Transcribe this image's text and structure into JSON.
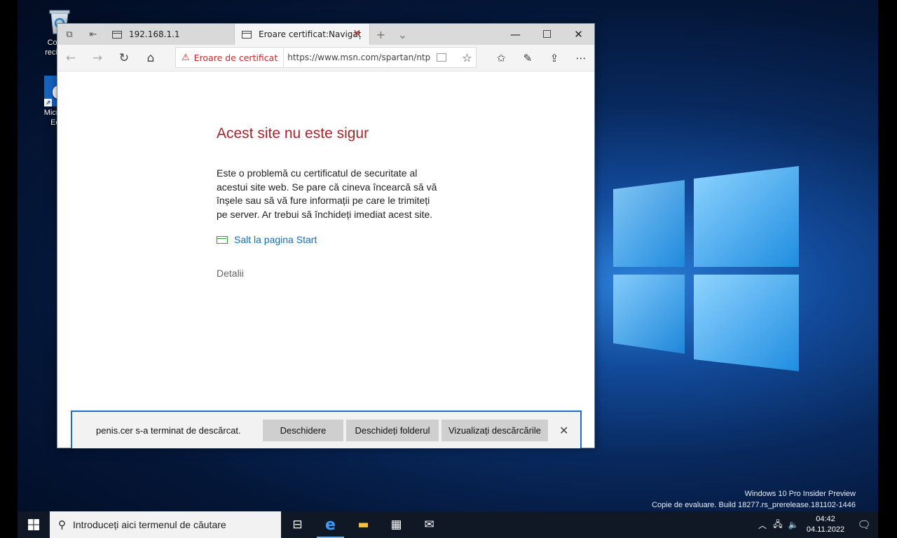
{
  "desktop": {
    "icons": [
      {
        "label": "Coș de reciclare"
      },
      {
        "label": "Microsoft Edge"
      }
    ],
    "watermark": {
      "line1": "Windows 10 Pro Insider Preview",
      "line2": "Copie de evaluare. Build 18277.rs_prerelease.181102-1446"
    }
  },
  "browser": {
    "tabs": [
      {
        "title": "192.168.1.1"
      },
      {
        "title": "Eroare certificat:Navigaț"
      }
    ],
    "address": {
      "cert_label": "Eroare de certificat",
      "url": "https://www.msn.com/spartan/ntp?lo"
    },
    "page": {
      "title": "Acest site nu este sigur",
      "body": "Este o problemă cu certificatul de securitate al acestui site web. Se pare că cineva încearcă să vă înșele sau să vă fure informații pe care le trimiteți pe server. Ar trebui să închideți imediat acest site.",
      "start_link": "Salt la pagina Start",
      "details": "Detalii"
    },
    "download": {
      "message": "penis.cer s-a terminat de descărcat.",
      "open": "Deschidere",
      "open_folder": "Deschideți folderul",
      "view_downloads": "Vizualizați descărcările"
    }
  },
  "taskbar": {
    "search_placeholder": "Introduceți aici termenul de căutare",
    "time": "04:42",
    "date": "04.11.2022"
  },
  "colors": {
    "error_red": "#a4262c",
    "link_blue": "#1a6bb8",
    "download_border": "#1e6fc4"
  }
}
